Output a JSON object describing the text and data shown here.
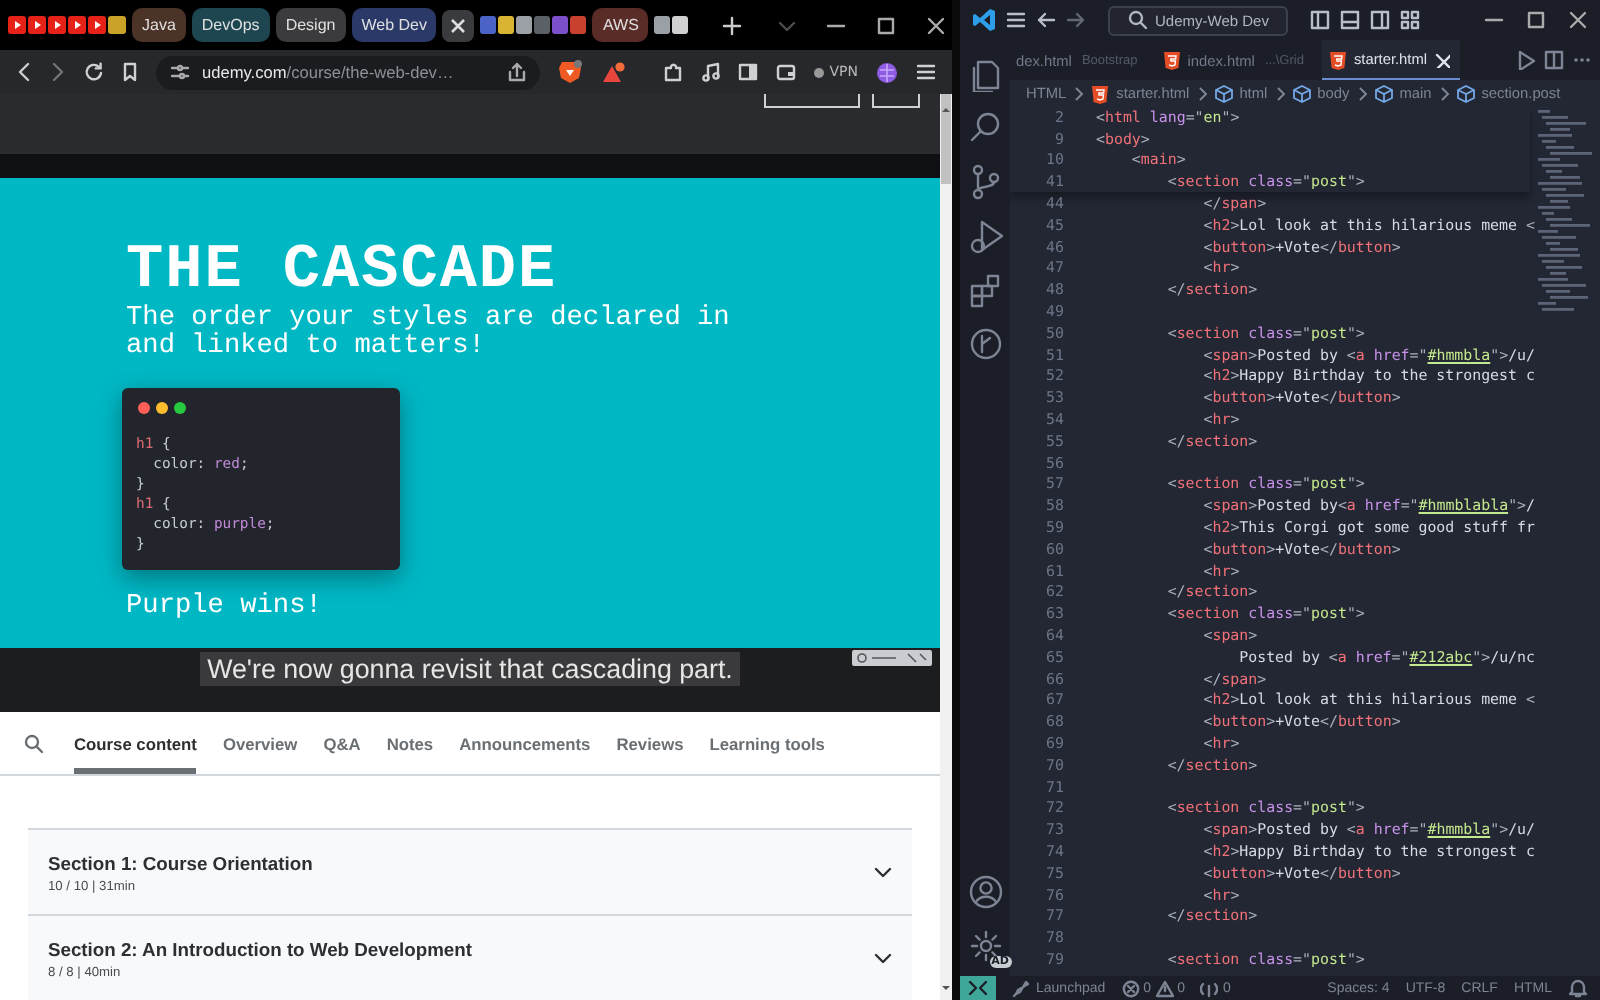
{
  "browser": {
    "tab_groups": [
      {
        "label": "Java",
        "color": "#4b3327"
      },
      {
        "label": "DevOps",
        "color": "#1d4650"
      },
      {
        "label": "Design",
        "color": "#3b3b3d"
      },
      {
        "label": "Web Dev",
        "color": "#2a3967"
      }
    ],
    "pinned_group": {
      "label": "AWS",
      "color": "#5a2c28"
    },
    "url": {
      "host": "udemy.com",
      "path": "/course/the-web-dev…"
    },
    "vpn": "VPN",
    "video": {
      "title": "THE CASCADE",
      "subtitle_lines": [
        "The order your styles are declared in",
        "and linked to matters!"
      ],
      "code": [
        "h1 {",
        "  color: red;",
        "}",
        "h1 {",
        "  color: purple;",
        "}"
      ],
      "conclusion": "Purple wins!",
      "caption": "We're now gonna revisit that cascading part."
    },
    "course_tabs": [
      {
        "label": "Course content",
        "selected": true
      },
      {
        "label": "Overview",
        "selected": false
      },
      {
        "label": "Q&A",
        "selected": false
      },
      {
        "label": "Notes",
        "selected": false
      },
      {
        "label": "Announcements",
        "selected": false
      },
      {
        "label": "Reviews",
        "selected": false
      },
      {
        "label": "Learning tools",
        "selected": false
      }
    ],
    "sections": [
      {
        "title": "Section 1: Course Orientation",
        "meta": "10 / 10 | 31min",
        "expanded": false
      },
      {
        "title": "Section 2: An Introduction to Web Development",
        "meta": "8 / 8 | 40min",
        "expanded": false
      }
    ]
  },
  "editor": {
    "search": "Udemy-Web Dev",
    "tabs": [
      {
        "name": "dex.html",
        "description": "Bootstrap",
        "selected": false
      },
      {
        "name": "index.html",
        "description": "...\\Grid",
        "selected": false
      },
      {
        "name": "starter.html",
        "selected": true
      }
    ],
    "breadcrumb": [
      {
        "label": "HTML",
        "kind": "language"
      },
      {
        "label": "starter.html",
        "kind": "file"
      },
      {
        "label": "html",
        "kind": "element"
      },
      {
        "label": "body",
        "kind": "element"
      },
      {
        "label": "main",
        "kind": "element"
      },
      {
        "label": "section.post",
        "kind": "element"
      }
    ],
    "sticky_lines": [
      {
        "number": "2",
        "code": "<html lang=\"en\">"
      },
      {
        "number": "9",
        "code": "<body>"
      },
      {
        "number": "10",
        "code": "    <main>"
      },
      {
        "number": "41",
        "code": "        <section class=\"post\">"
      }
    ],
    "lines": [
      {
        "number": "44",
        "code": "            </span>"
      },
      {
        "number": "45",
        "code": "            <h2>Lol look at this hilarious meme <"
      },
      {
        "number": "46",
        "code": "            <button>+Vote</button>"
      },
      {
        "number": "47",
        "code": "            <hr>"
      },
      {
        "number": "48",
        "code": "        </section>"
      },
      {
        "number": "49"
      },
      {
        "number": "50",
        "code": "        <section class=\"post\">"
      },
      {
        "number": "51",
        "code": "            <span>Posted by <a href=\"#hmmbla\">/u/"
      },
      {
        "number": "52",
        "code": "            <h2>Happy Birthday to the strongest c"
      },
      {
        "number": "53",
        "code": "            <button>+Vote</button>"
      },
      {
        "number": "54",
        "code": "            <hr>"
      },
      {
        "number": "55",
        "code": "        </section>"
      },
      {
        "number": "56"
      },
      {
        "number": "57",
        "code": "        <section class=\"post\">"
      },
      {
        "number": "58",
        "code": "            <span>Posted by<a href=\"#hmmblabla\">/"
      },
      {
        "number": "59",
        "code": "            <h2>This Corgi got some good stuff fr"
      },
      {
        "number": "60",
        "code": "            <button>+Vote</button>"
      },
      {
        "number": "61",
        "code": "            <hr>"
      },
      {
        "number": "62",
        "code": "        </section>"
      },
      {
        "number": "63",
        "code": "        <section class=\"post\">"
      },
      {
        "number": "64",
        "code": "            <span>"
      },
      {
        "number": "65",
        "code": "                Posted by <a href=\"#212abc\">/u/nc"
      },
      {
        "number": "66",
        "code": "            </span>"
      },
      {
        "number": "67",
        "code": "            <h2>Lol look at this hilarious meme <"
      },
      {
        "number": "68",
        "code": "            <button>+Vote</button>"
      },
      {
        "number": "69",
        "code": "            <hr>"
      },
      {
        "number": "70",
        "code": "        </section>"
      },
      {
        "number": "71"
      },
      {
        "number": "72",
        "code": "        <section class=\"post\">"
      },
      {
        "number": "73",
        "code": "            <span>Posted by <a href=\"#hmmbla\">/u/"
      },
      {
        "number": "74",
        "code": "            <h2>Happy Birthday to the strongest c"
      },
      {
        "number": "75",
        "code": "            <button>+Vote</button>"
      },
      {
        "number": "76",
        "code": "            <hr>"
      },
      {
        "number": "77",
        "code": "        </section>"
      },
      {
        "number": "78"
      },
      {
        "number": "79",
        "code": "        <section class=\"post\">"
      }
    ],
    "account_badge": "AD",
    "status_bar": {
      "launchpad": "Launchpad",
      "errors": "0",
      "warnings": "0",
      "ports": "0",
      "indent": "Spaces: 4",
      "encoding": "UTF-8",
      "line_ending": "CRLF",
      "language": "HTML"
    }
  }
}
